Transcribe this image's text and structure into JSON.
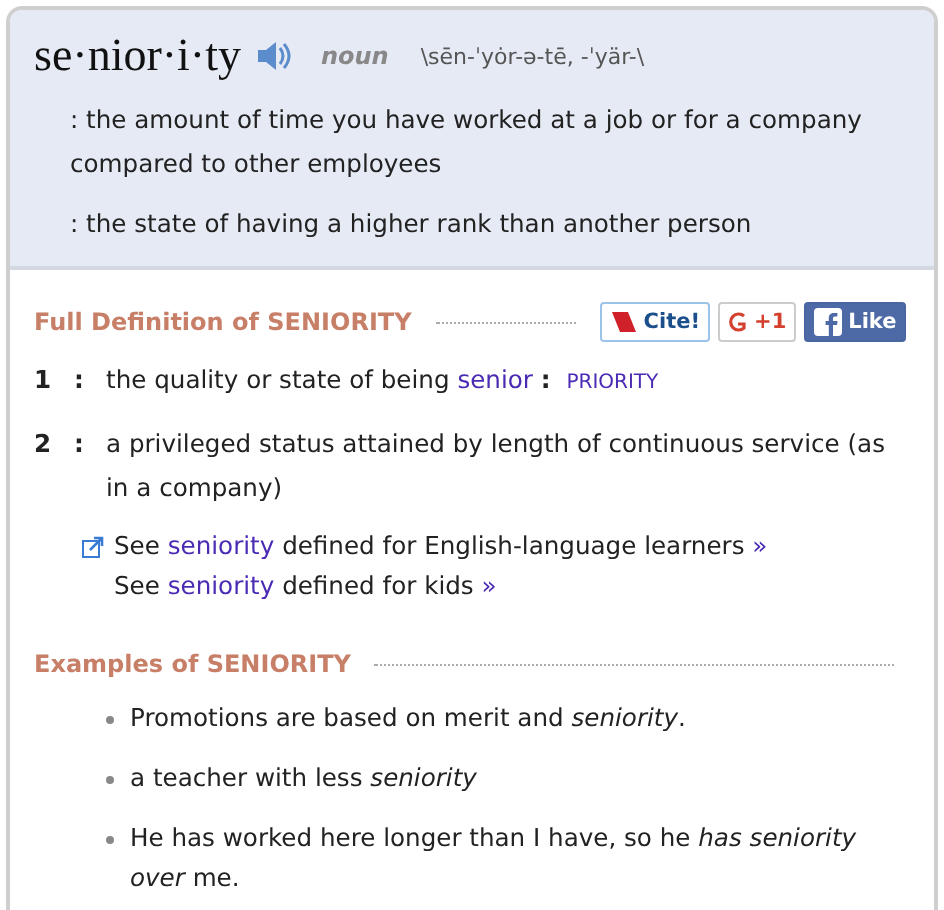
{
  "headword": {
    "word": "se·nior·i·ty",
    "part_of_speech": "noun",
    "pronunciation": "\\sēn-ˈyȯr-ə-tē, -ˈyär-\\"
  },
  "learner_definitions": [
    ": the amount of time you have worked at a job or for a company compared to other employees",
    ": the state of having a higher rank than another person"
  ],
  "full_definition": {
    "heading": "Full Definition of SENIORITY",
    "share_buttons": [
      {
        "kind": "cite",
        "label": "Cite!"
      },
      {
        "kind": "gplus",
        "label": "+1"
      },
      {
        "kind": "like",
        "label": "Like"
      }
    ],
    "senses": [
      {
        "number": "1",
        "separator": ":",
        "text": "the quality or state of being",
        "link": "senior",
        "cross_ref_separator": ":",
        "cross_ref": "PRIORITY"
      },
      {
        "number": "2",
        "separator": ":",
        "text": "a privileged status attained by length of continuous service (as in a company)"
      }
    ],
    "see_also": [
      {
        "icon": true,
        "prefix": "See",
        "link": "seniority",
        "suffix": "defined for English-language learners",
        "more": "»"
      },
      {
        "icon": false,
        "prefix": "See",
        "link": "seniority",
        "suffix": "defined for kids",
        "more": "»"
      }
    ]
  },
  "examples": {
    "heading": "Examples of SENIORITY",
    "items": [
      "Promotions are based on merit and *seniority*.",
      "a teacher with less *seniority*",
      "He has worked here longer than I have, so he *has seniority over* me."
    ]
  }
}
